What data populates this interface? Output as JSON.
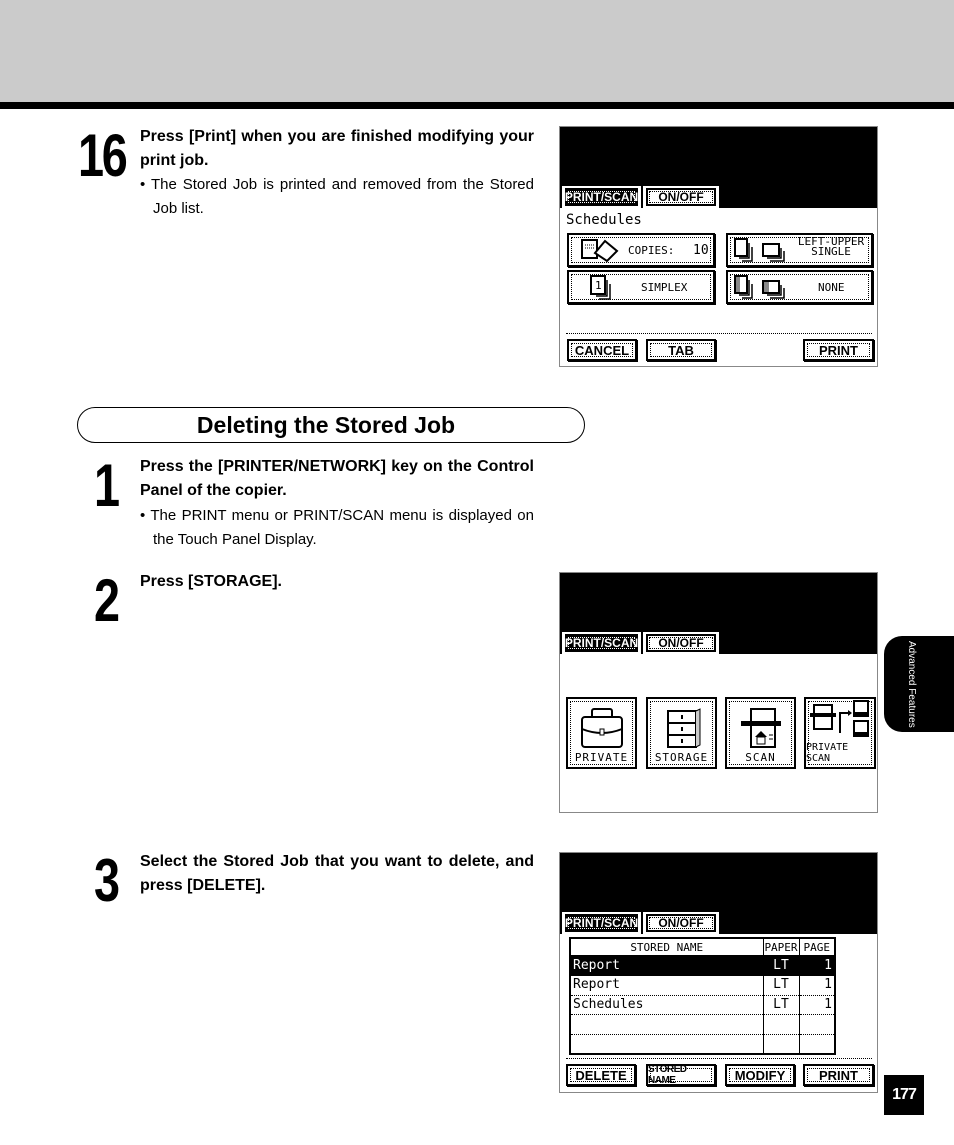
{
  "page_number": "177",
  "side_tab": "Advanced Features",
  "section_title": "Deleting the Stored Job",
  "steps": [
    {
      "number": "16",
      "title": "Press [Print] when you are finished modifying your print job.",
      "bullet": "• The Stored Job is printed and removed from the Stored Job list."
    },
    {
      "number": "1",
      "title": "Press the [PRINTER/NETWORK] key on the Control Panel of the copier.",
      "bullet": "• The PRINT menu or PRINT/SCAN menu is displayed on the Touch Panel Display."
    },
    {
      "number": "2",
      "title": "Press [STORAGE]."
    },
    {
      "number": "3",
      "title": "Select the Stored Job that you want to delete, and press [DELETE]."
    }
  ],
  "panel_tabs": {
    "print_scan": "PRINT/SCAN",
    "on_off": "ON/OFF"
  },
  "panel1": {
    "job_name": "Schedules",
    "options": [
      {
        "icon": "copies-icon",
        "label": "COPIES:",
        "value": "10"
      },
      {
        "icon": "staple-icon",
        "label": "LEFT-UPPER",
        "label2": "SINGLE"
      },
      {
        "icon": "simplex-icon",
        "label": "SIMPLEX"
      },
      {
        "icon": "hole-punch-icon",
        "label": "NONE"
      }
    ],
    "buttons": {
      "cancel": "CANCEL",
      "tab": "TAB",
      "print": "PRINT"
    }
  },
  "panel2": {
    "items": [
      {
        "icon": "briefcase-icon",
        "label": "PRIVATE"
      },
      {
        "icon": "cabinet-icon",
        "label": "STORAGE"
      },
      {
        "icon": "scanner-icon",
        "label": "SCAN"
      },
      {
        "icon": "network-scan-icon",
        "label": "PRIVATE SCAN"
      }
    ]
  },
  "panel3": {
    "columns": [
      "STORED NAME",
      "PAPER",
      "PAGE"
    ],
    "rows": [
      {
        "name": "Report",
        "paper": "LT",
        "page": "1",
        "selected": true
      },
      {
        "name": "Report",
        "paper": "LT",
        "page": "1",
        "selected": false
      },
      {
        "name": "Schedules",
        "paper": "LT",
        "page": "1",
        "selected": false
      },
      {
        "name": "",
        "paper": "",
        "page": "",
        "selected": false
      },
      {
        "name": "",
        "paper": "",
        "page": "",
        "selected": false
      }
    ],
    "buttons": {
      "delete": "DELETE",
      "stored_name": "STORED NAME",
      "modify": "MODIFY",
      "print": "PRINT"
    }
  }
}
